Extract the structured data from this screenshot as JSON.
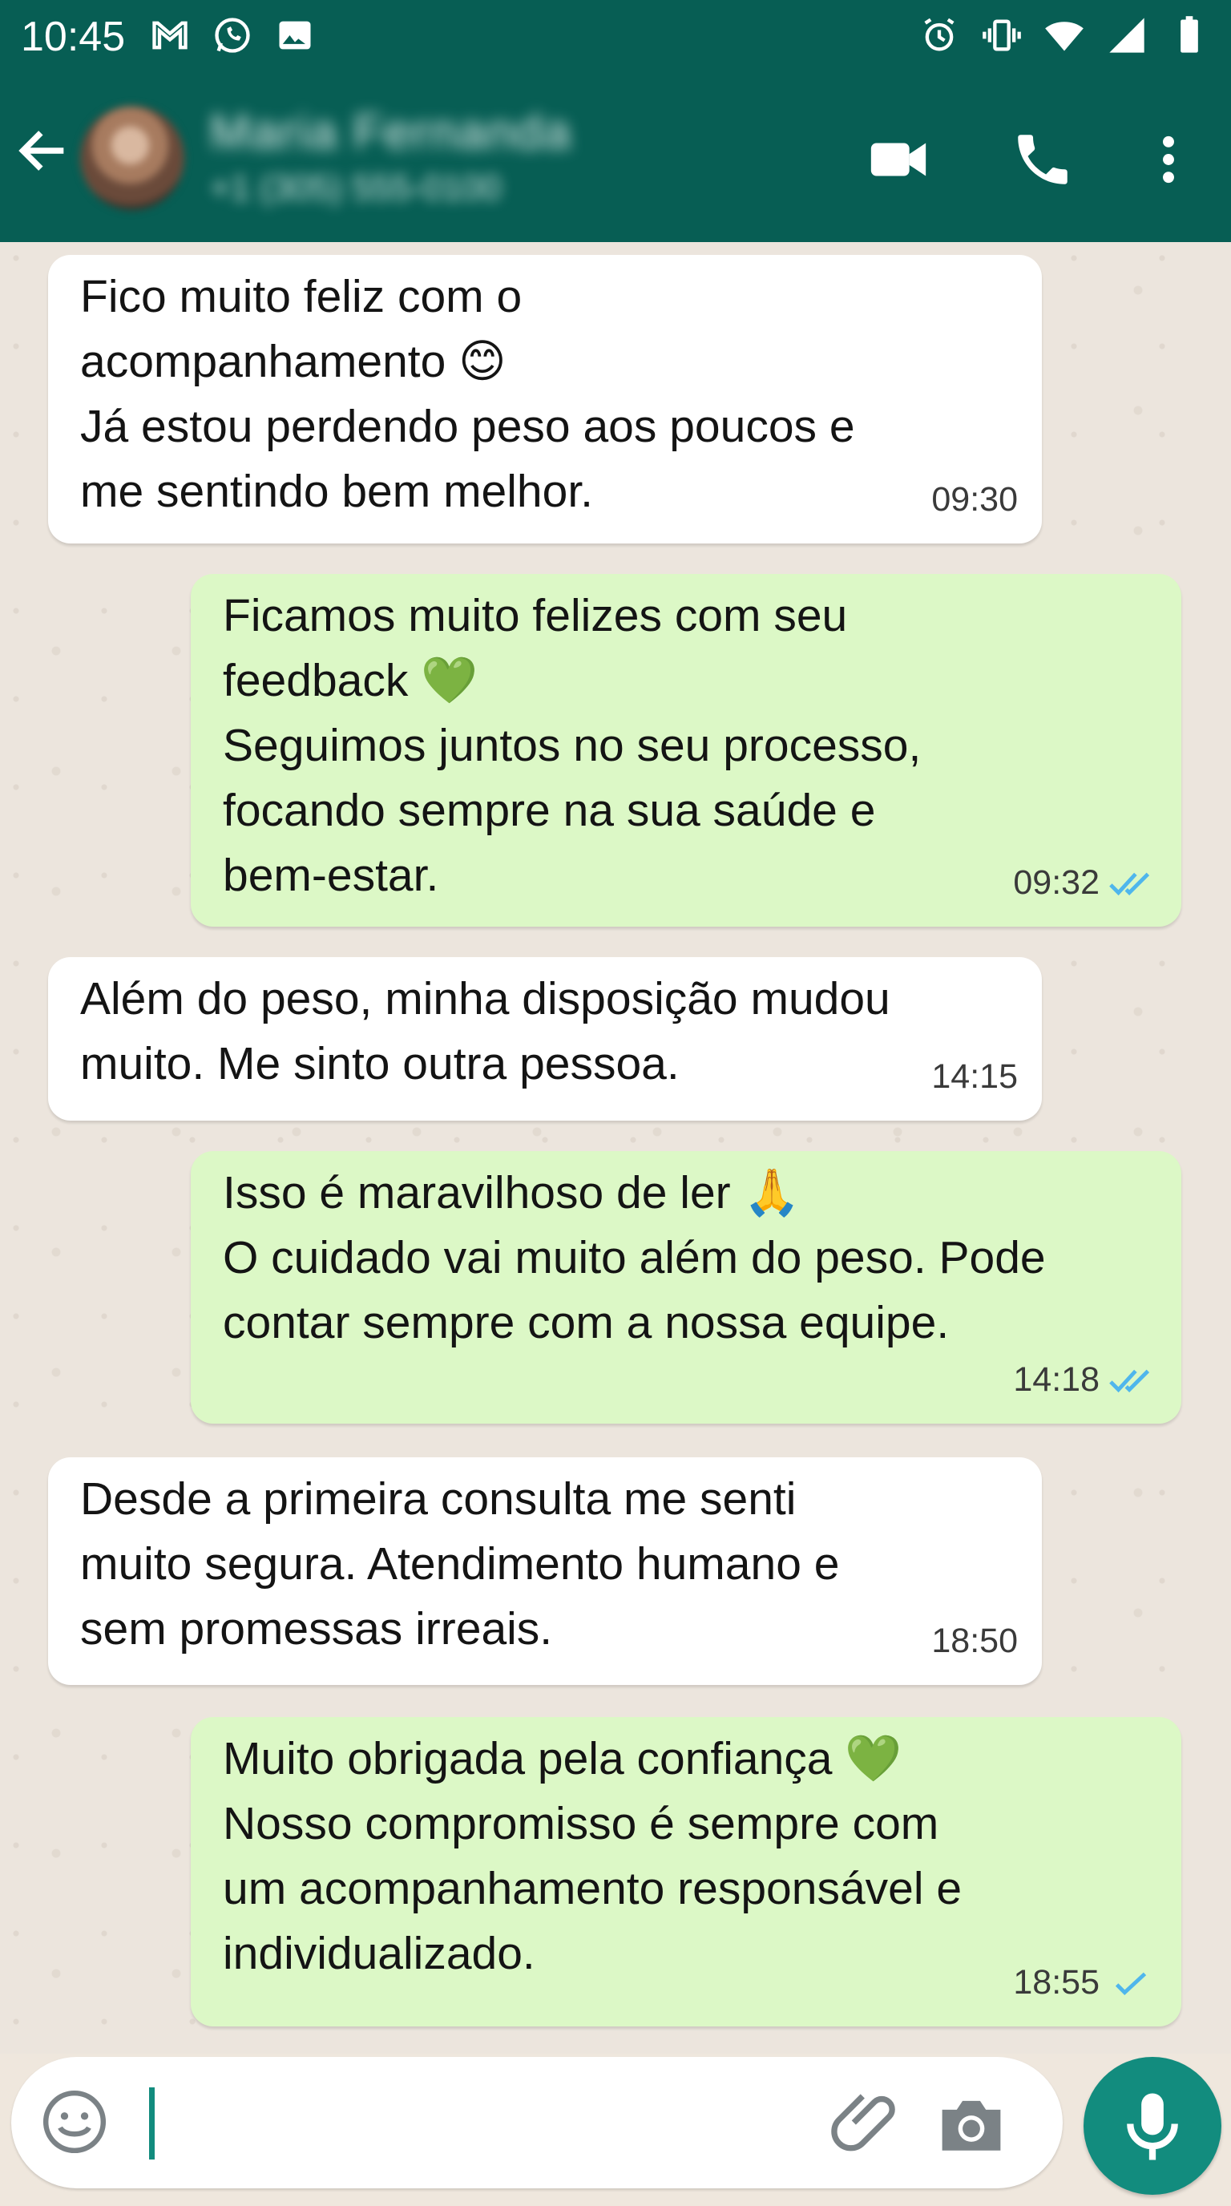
{
  "status_bar": {
    "time": "10:45",
    "left_icons": [
      "gmail-icon",
      "whatsapp-icon",
      "image-icon"
    ],
    "right_icons": [
      "alarm-icon",
      "vibrate-icon",
      "wifi-icon",
      "signal-icon",
      "battery-icon"
    ]
  },
  "header": {
    "contact_name": "Maria Fernanda",
    "contact_phone": "+1 (305) 555-0100",
    "icons": [
      "back-arrow-icon",
      "video-call-icon",
      "phone-call-icon",
      "more-menu-icon"
    ],
    "background_color": "#075e54"
  },
  "messages": [
    {
      "direction": "incoming",
      "text": "Fico muito feliz com o\nacompanhamento 😊\nJá estou perdendo peso aos poucos e\nme sentindo bem melhor.",
      "time": "09:30"
    },
    {
      "direction": "outgoing",
      "text": "Ficamos muito felizes com seu\nfeedback 💚\nSeguimos juntos no seu processo,\nfocando sempre na sua saúde e\nbem-estar.",
      "time": "09:32",
      "status": "read"
    },
    {
      "direction": "incoming",
      "text": "Além do peso, minha disposição mudou\nmuito. Me sinto outra pessoa.",
      "time": "14:15"
    },
    {
      "direction": "outgoing",
      "text": "Isso é maravilhoso de ler 🙏\nO cuidado vai muito além do peso. Pode\ncontar sempre com a nossa equipe.",
      "time": "14:18",
      "status": "read"
    },
    {
      "direction": "incoming",
      "text": "Desde a primeira consulta me senti\nmuito segura. Atendimento humano e\nsem promessas irreais.",
      "time": "18:50"
    },
    {
      "direction": "outgoing",
      "text": "Muito obrigada pela confiança 💚\nNosso compromisso é sempre com\num acompanhamento responsável e\nindividualizado.",
      "time": "18:55",
      "status": "sent"
    }
  ],
  "colors": {
    "incoming_bubble": "#ffffff",
    "outgoing_bubble": "#dcf8c6",
    "read_tick": "#4fb6ec",
    "accent": "#128c7e"
  },
  "input": {
    "value": "",
    "icons": [
      "emoji-icon",
      "attach-icon",
      "camera-icon",
      "microphone-icon"
    ]
  }
}
